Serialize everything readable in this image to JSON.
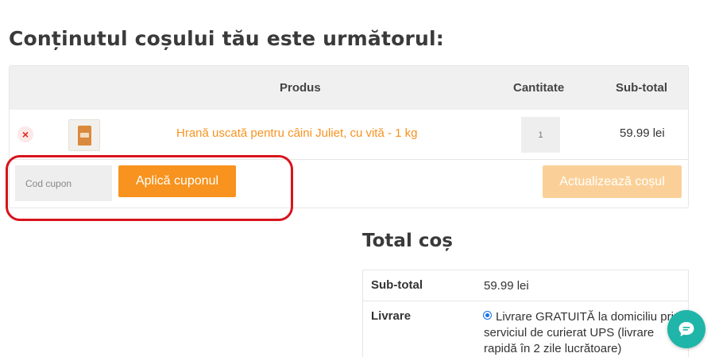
{
  "page": {
    "title": "Conținutul coșului tău este următorul:"
  },
  "cart": {
    "headers": {
      "product": "Produs",
      "quantity": "Cantitate",
      "subtotal": "Sub-total"
    },
    "items": [
      {
        "remove_icon": "×",
        "name": "Hrană uscată pentru câini Juliet, cu vită - 1 kg",
        "quantity": "1",
        "subtotal": "59.99 lei"
      }
    ],
    "coupon": {
      "placeholder": "Cod cupon",
      "apply_label": "Aplică cuponul"
    },
    "update_label": "Actualizează coșul"
  },
  "totals": {
    "title": "Total coș",
    "subtotal_label": "Sub-total",
    "subtotal_value": "59.99 lei",
    "shipping_label": "Livrare",
    "shipping_option": "Livrare GRATUITĂ la domiciliu prin serviciul de curierat UPS (livrare rapidă în 2 zile lucrătoare)"
  },
  "colors": {
    "accent": "#f7931e",
    "accent_disabled": "#fbd098",
    "highlight": "#d8131b",
    "chat": "#1fb5a8"
  },
  "icons": {
    "remove": "close-icon",
    "chat": "chat-bubble-icon"
  }
}
